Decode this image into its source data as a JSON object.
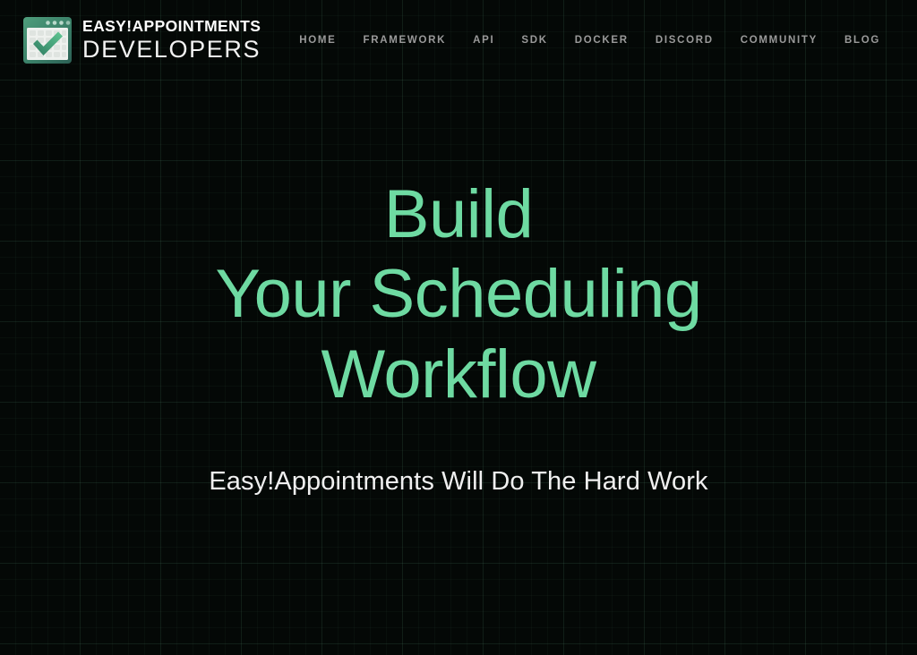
{
  "theme": {
    "background": "#040806",
    "accent_green": "#6edaa2",
    "nav_text": "#9a9a9a",
    "heading_text": "#6edaa2",
    "subtitle_text": "#f0f0f0",
    "logo_green_light": "#5fb98c",
    "logo_green_dark": "#2f6a5a"
  },
  "header": {
    "brand": {
      "logo_icon": "calendar-check-icon",
      "title": "EASY!APPOINTMENTS",
      "subtitle": "DEVELOPERS"
    },
    "nav": {
      "items": [
        {
          "label": "HOME"
        },
        {
          "label": "FRAMEWORK"
        },
        {
          "label": "API"
        },
        {
          "label": "SDK"
        },
        {
          "label": "DOCKER"
        },
        {
          "label": "DISCORD"
        },
        {
          "label": "COMMUNITY"
        },
        {
          "label": "BLOG"
        }
      ]
    }
  },
  "hero": {
    "title_lines": [
      "Build",
      "Your Scheduling",
      "Workflow"
    ],
    "subtitle": "Easy!Appointments Will Do The Hard Work"
  }
}
